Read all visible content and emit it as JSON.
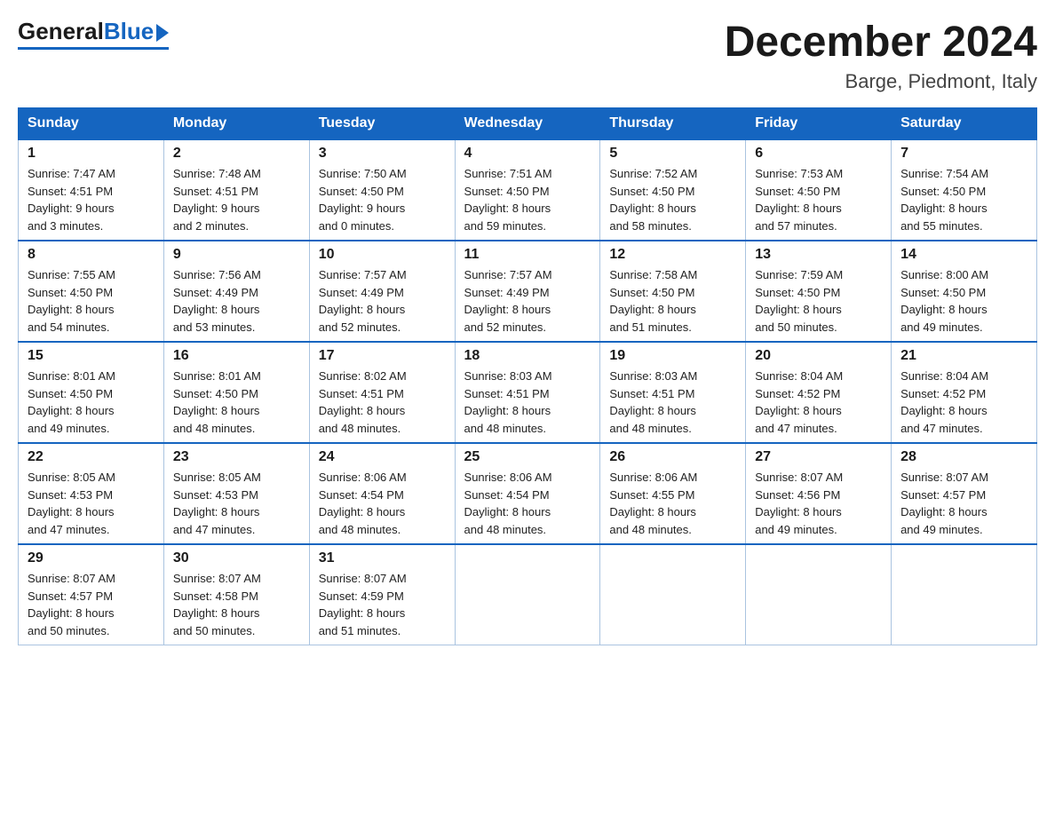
{
  "logo": {
    "general": "General",
    "blue": "Blue"
  },
  "header": {
    "month": "December 2024",
    "location": "Barge, Piedmont, Italy"
  },
  "weekdays": [
    "Sunday",
    "Monday",
    "Tuesday",
    "Wednesday",
    "Thursday",
    "Friday",
    "Saturday"
  ],
  "weeks": [
    [
      {
        "day": "1",
        "sunrise": "Sunrise: 7:47 AM",
        "sunset": "Sunset: 4:51 PM",
        "daylight": "Daylight: 9 hours",
        "daylight2": "and 3 minutes."
      },
      {
        "day": "2",
        "sunrise": "Sunrise: 7:48 AM",
        "sunset": "Sunset: 4:51 PM",
        "daylight": "Daylight: 9 hours",
        "daylight2": "and 2 minutes."
      },
      {
        "day": "3",
        "sunrise": "Sunrise: 7:50 AM",
        "sunset": "Sunset: 4:50 PM",
        "daylight": "Daylight: 9 hours",
        "daylight2": "and 0 minutes."
      },
      {
        "day": "4",
        "sunrise": "Sunrise: 7:51 AM",
        "sunset": "Sunset: 4:50 PM",
        "daylight": "Daylight: 8 hours",
        "daylight2": "and 59 minutes."
      },
      {
        "day": "5",
        "sunrise": "Sunrise: 7:52 AM",
        "sunset": "Sunset: 4:50 PM",
        "daylight": "Daylight: 8 hours",
        "daylight2": "and 58 minutes."
      },
      {
        "day": "6",
        "sunrise": "Sunrise: 7:53 AM",
        "sunset": "Sunset: 4:50 PM",
        "daylight": "Daylight: 8 hours",
        "daylight2": "and 57 minutes."
      },
      {
        "day": "7",
        "sunrise": "Sunrise: 7:54 AM",
        "sunset": "Sunset: 4:50 PM",
        "daylight": "Daylight: 8 hours",
        "daylight2": "and 55 minutes."
      }
    ],
    [
      {
        "day": "8",
        "sunrise": "Sunrise: 7:55 AM",
        "sunset": "Sunset: 4:50 PM",
        "daylight": "Daylight: 8 hours",
        "daylight2": "and 54 minutes."
      },
      {
        "day": "9",
        "sunrise": "Sunrise: 7:56 AM",
        "sunset": "Sunset: 4:49 PM",
        "daylight": "Daylight: 8 hours",
        "daylight2": "and 53 minutes."
      },
      {
        "day": "10",
        "sunrise": "Sunrise: 7:57 AM",
        "sunset": "Sunset: 4:49 PM",
        "daylight": "Daylight: 8 hours",
        "daylight2": "and 52 minutes."
      },
      {
        "day": "11",
        "sunrise": "Sunrise: 7:57 AM",
        "sunset": "Sunset: 4:49 PM",
        "daylight": "Daylight: 8 hours",
        "daylight2": "and 52 minutes."
      },
      {
        "day": "12",
        "sunrise": "Sunrise: 7:58 AM",
        "sunset": "Sunset: 4:50 PM",
        "daylight": "Daylight: 8 hours",
        "daylight2": "and 51 minutes."
      },
      {
        "day": "13",
        "sunrise": "Sunrise: 7:59 AM",
        "sunset": "Sunset: 4:50 PM",
        "daylight": "Daylight: 8 hours",
        "daylight2": "and 50 minutes."
      },
      {
        "day": "14",
        "sunrise": "Sunrise: 8:00 AM",
        "sunset": "Sunset: 4:50 PM",
        "daylight": "Daylight: 8 hours",
        "daylight2": "and 49 minutes."
      }
    ],
    [
      {
        "day": "15",
        "sunrise": "Sunrise: 8:01 AM",
        "sunset": "Sunset: 4:50 PM",
        "daylight": "Daylight: 8 hours",
        "daylight2": "and 49 minutes."
      },
      {
        "day": "16",
        "sunrise": "Sunrise: 8:01 AM",
        "sunset": "Sunset: 4:50 PM",
        "daylight": "Daylight: 8 hours",
        "daylight2": "and 48 minutes."
      },
      {
        "day": "17",
        "sunrise": "Sunrise: 8:02 AM",
        "sunset": "Sunset: 4:51 PM",
        "daylight": "Daylight: 8 hours",
        "daylight2": "and 48 minutes."
      },
      {
        "day": "18",
        "sunrise": "Sunrise: 8:03 AM",
        "sunset": "Sunset: 4:51 PM",
        "daylight": "Daylight: 8 hours",
        "daylight2": "and 48 minutes."
      },
      {
        "day": "19",
        "sunrise": "Sunrise: 8:03 AM",
        "sunset": "Sunset: 4:51 PM",
        "daylight": "Daylight: 8 hours",
        "daylight2": "and 48 minutes."
      },
      {
        "day": "20",
        "sunrise": "Sunrise: 8:04 AM",
        "sunset": "Sunset: 4:52 PM",
        "daylight": "Daylight: 8 hours",
        "daylight2": "and 47 minutes."
      },
      {
        "day": "21",
        "sunrise": "Sunrise: 8:04 AM",
        "sunset": "Sunset: 4:52 PM",
        "daylight": "Daylight: 8 hours",
        "daylight2": "and 47 minutes."
      }
    ],
    [
      {
        "day": "22",
        "sunrise": "Sunrise: 8:05 AM",
        "sunset": "Sunset: 4:53 PM",
        "daylight": "Daylight: 8 hours",
        "daylight2": "and 47 minutes."
      },
      {
        "day": "23",
        "sunrise": "Sunrise: 8:05 AM",
        "sunset": "Sunset: 4:53 PM",
        "daylight": "Daylight: 8 hours",
        "daylight2": "and 47 minutes."
      },
      {
        "day": "24",
        "sunrise": "Sunrise: 8:06 AM",
        "sunset": "Sunset: 4:54 PM",
        "daylight": "Daylight: 8 hours",
        "daylight2": "and 48 minutes."
      },
      {
        "day": "25",
        "sunrise": "Sunrise: 8:06 AM",
        "sunset": "Sunset: 4:54 PM",
        "daylight": "Daylight: 8 hours",
        "daylight2": "and 48 minutes."
      },
      {
        "day": "26",
        "sunrise": "Sunrise: 8:06 AM",
        "sunset": "Sunset: 4:55 PM",
        "daylight": "Daylight: 8 hours",
        "daylight2": "and 48 minutes."
      },
      {
        "day": "27",
        "sunrise": "Sunrise: 8:07 AM",
        "sunset": "Sunset: 4:56 PM",
        "daylight": "Daylight: 8 hours",
        "daylight2": "and 49 minutes."
      },
      {
        "day": "28",
        "sunrise": "Sunrise: 8:07 AM",
        "sunset": "Sunset: 4:57 PM",
        "daylight": "Daylight: 8 hours",
        "daylight2": "and 49 minutes."
      }
    ],
    [
      {
        "day": "29",
        "sunrise": "Sunrise: 8:07 AM",
        "sunset": "Sunset: 4:57 PM",
        "daylight": "Daylight: 8 hours",
        "daylight2": "and 50 minutes."
      },
      {
        "day": "30",
        "sunrise": "Sunrise: 8:07 AM",
        "sunset": "Sunset: 4:58 PM",
        "daylight": "Daylight: 8 hours",
        "daylight2": "and 50 minutes."
      },
      {
        "day": "31",
        "sunrise": "Sunrise: 8:07 AM",
        "sunset": "Sunset: 4:59 PM",
        "daylight": "Daylight: 8 hours",
        "daylight2": "and 51 minutes."
      },
      null,
      null,
      null,
      null
    ]
  ]
}
